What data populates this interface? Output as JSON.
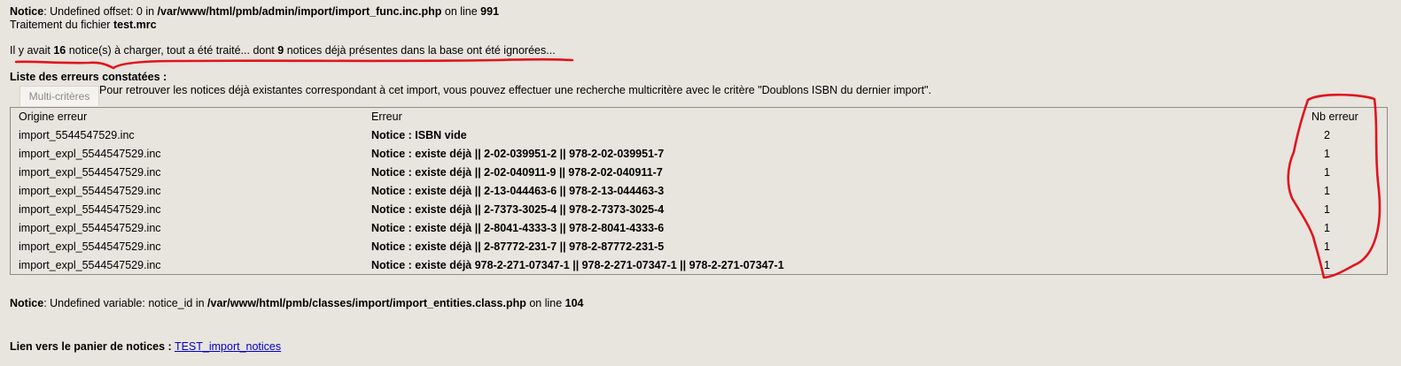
{
  "notices": {
    "n1": {
      "label": "Notice",
      "rest": ": Undefined offset: 0 in ",
      "path": "/var/www/html/pmb/admin/import/import_func.inc.php",
      "on_line": " on line ",
      "line": "991"
    },
    "file": {
      "prefix": "Traitement du fichier ",
      "name": "test.mrc"
    },
    "summary": {
      "p1": "Il y avait ",
      "count": "16",
      "p2": " notice(s) à charger, tout a été traité... dont ",
      "dup": "9",
      "p3": " notices déjà présentes dans la base ont été ignorées..."
    },
    "n2": {
      "label": "Notice",
      "rest": ": Undefined variable: notice_id in ",
      "path": "/var/www/html/pmb/classes/import/import_entities.class.php",
      "on_line": " on line ",
      "line": "104"
    }
  },
  "errors_section": {
    "title": "Liste des erreurs constatées :",
    "tab": "Multi-critères",
    "info": "Pour retrouver les notices déjà existantes correspondant à cet import, vous pouvez effectuer une recherche multicritère avec le critère \"Doublons ISBN du dernier import\"."
  },
  "table": {
    "headers": [
      "Origine erreur",
      "Erreur",
      "Nb erreur"
    ],
    "rows": [
      [
        "import_5544547529.inc",
        "Notice : ISBN vide",
        "2"
      ],
      [
        "import_expl_5544547529.inc",
        "Notice : existe déjà || 2-02-039951-2 || 978-2-02-039951-7",
        "1"
      ],
      [
        "import_expl_5544547529.inc",
        "Notice : existe déjà || 2-02-040911-9 || 978-2-02-040911-7",
        "1"
      ],
      [
        "import_expl_5544547529.inc",
        "Notice : existe déjà || 2-13-044463-6 || 978-2-13-044463-3",
        "1"
      ],
      [
        "import_expl_5544547529.inc",
        "Notice : existe déjà || 2-7373-3025-4 || 978-2-7373-3025-4",
        "1"
      ],
      [
        "import_expl_5544547529.inc",
        "Notice : existe déjà || 2-8041-4333-3 || 978-2-8041-4333-6",
        "1"
      ],
      [
        "import_expl_5544547529.inc",
        "Notice : existe déjà || 2-87772-231-7 || 978-2-87772-231-5",
        "1"
      ],
      [
        "import_expl_5544547529.inc",
        "Notice : existe déjà 978-2-271-07347-1 || 978-2-271-07347-1 || 978-2-271-07347-1",
        "1"
      ]
    ]
  },
  "basket": {
    "label": "Lien vers le panier de notices :",
    "link": "TEST_import_notices"
  },
  "colors": {
    "annotation": "#e0141e",
    "link": "#0000cc",
    "background": "#e8e4de"
  }
}
